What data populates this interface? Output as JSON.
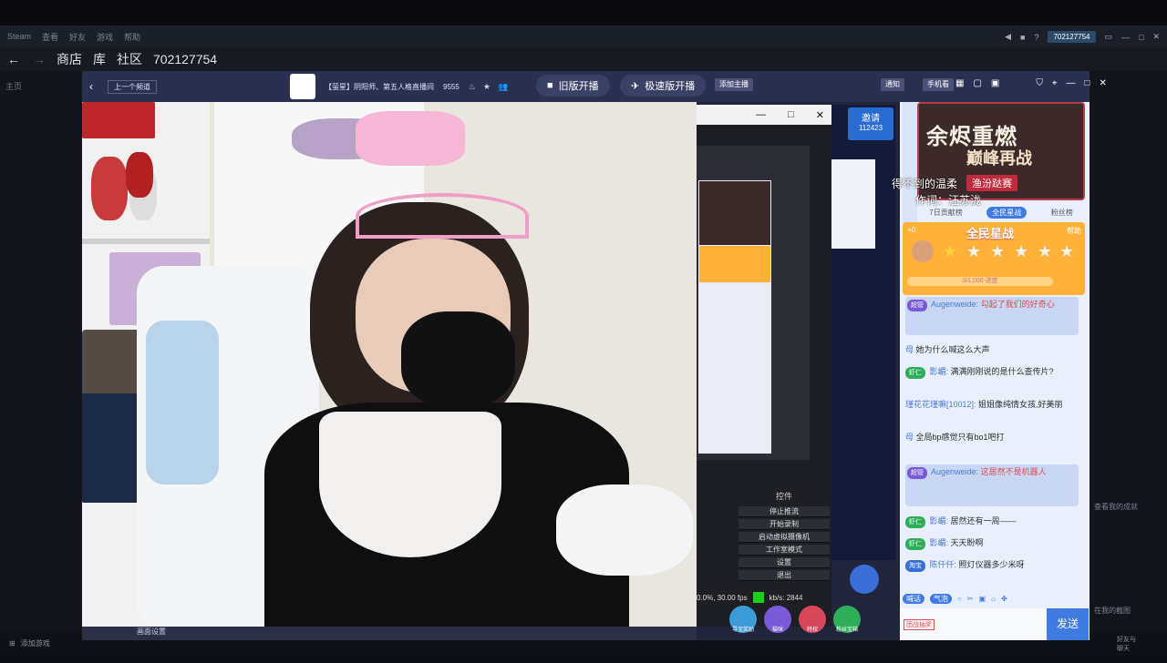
{
  "steam": {
    "menu": [
      "Steam",
      "查看",
      "好友",
      "游戏",
      "帮助"
    ],
    "nav": {
      "shop": "商店",
      "library": "库",
      "community": "社区",
      "account_id": "702127754"
    },
    "home": "主页",
    "top_right_id": "702127754",
    "add_game": "添加游戏",
    "friends_chat": "好友与\n聊天",
    "right_texts": [
      "查看我的成就",
      "在我的截图"
    ]
  },
  "live": {
    "back_label": "上一个频道",
    "channel_title": "【萤星】阴阳师、第五人格直播间",
    "viewer_count": "9555",
    "old_start_btn": "旧版开播",
    "fast_start_btn": "极速版开播",
    "add_host_btn": "添加主播",
    "notify_btn": "通知",
    "phone_btn": "手机看",
    "invite_label": "邀请",
    "invite_count": "112423",
    "video_settings": "画面设置"
  },
  "obs": {
    "controls_title": "控件",
    "buttons": [
      "停止推流",
      "开始录制",
      "启动虚拟摄像机",
      "工作室模式",
      "设置",
      "退出"
    ],
    "status": "0.0%, 30.00 fps",
    "kbps": "kb/s: 2844"
  },
  "chat": {
    "banner_title": "余烬重燃",
    "banner_sub": "巅峰再战",
    "banner_tag": "渔汾跶赛",
    "overlay_line1": "得不到的温柔",
    "overlay_line2": "作词：汪苏泷",
    "tabs": [
      "7日贡献榜",
      "全民星战",
      "粉丝榜"
    ],
    "star_title": "全民星战",
    "star_plus": "+0",
    "star_help": "帮助",
    "star_progress": "0/1,000 进度",
    "messages": [
      {
        "badge": "超管",
        "user": "Augenweide:",
        "text": "勾起了我们的好奇心",
        "red": true
      },
      {
        "badge": "",
        "user": "母",
        "text": "她为什么喊这么大声",
        "red": false
      },
      {
        "badge": "虾仁",
        "user": "影嵋:",
        "text": "满满刚刚说的是什么查传片?",
        "red": false
      },
      {
        "badge": "",
        "user": "瑾花花瑾嘛[10012]:",
        "text": "姐姐像纯情女孩,好美丽",
        "red": false
      },
      {
        "badge": "",
        "user": "母",
        "text": "全局bp感觉只有bo1吧打",
        "red": false
      },
      {
        "badge": "超管",
        "user": "Augenweide:",
        "text": "这居然不是机器人",
        "red": true
      },
      {
        "badge": "虾仁",
        "user": "影嵋:",
        "text": "居然还有一周——",
        "red": false
      },
      {
        "badge": "虾仁",
        "user": "影嵋:",
        "text": "天天盼啊",
        "red": false
      },
      {
        "badge": "淘宝",
        "user": "陈仟仟:",
        "text": "照灯仪器多少米呀",
        "red": false
      }
    ],
    "toolbar": [
      "喊话",
      "气泡"
    ],
    "send_btn": "发送",
    "bottom_btn": "团战抽奖"
  },
  "gifts": [
    "寻宝奖励",
    "猫咪",
    "特权",
    "粉丝宝箱"
  ]
}
